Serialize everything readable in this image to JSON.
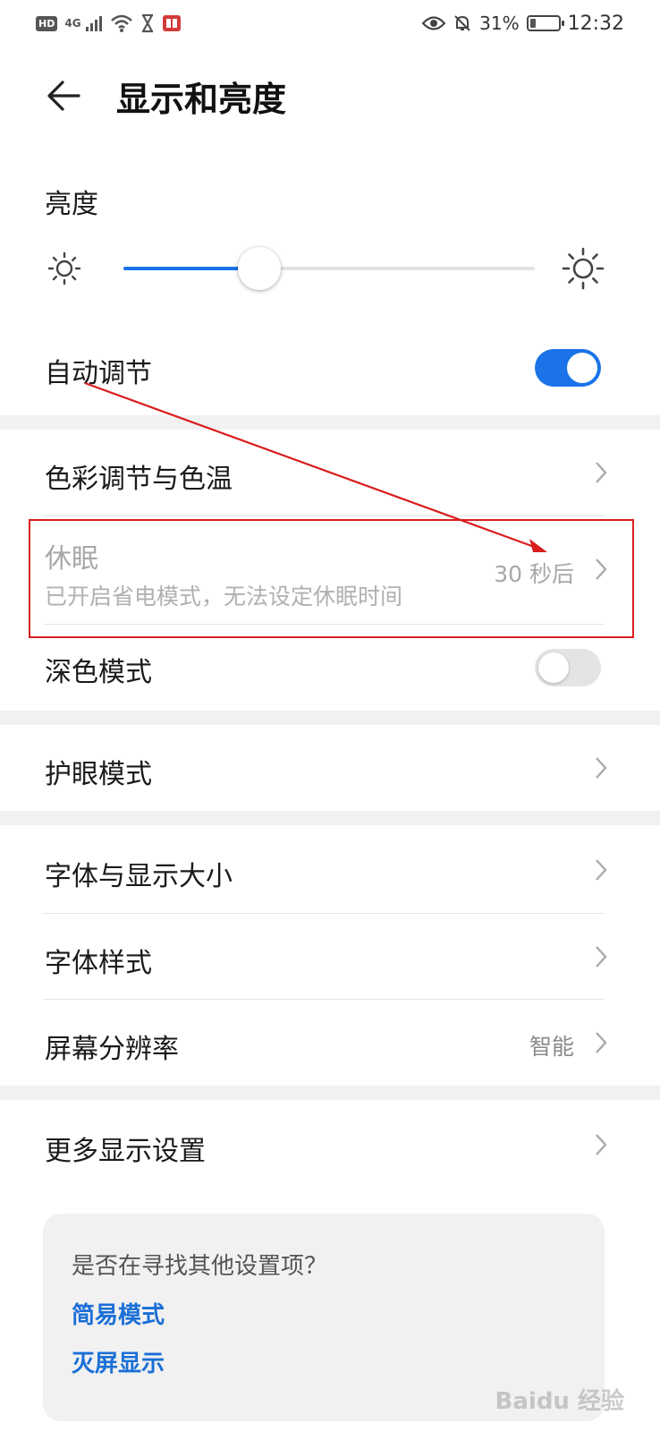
{
  "status_bar": {
    "hd": "HD",
    "network": "4G",
    "battery_percent": "31%",
    "battery_level": 0.31,
    "time": "12:32",
    "left_icons": [
      "hd-icon",
      "signal-icon",
      "wifi-icon",
      "hourglass-icon",
      "book-icon"
    ],
    "right_icons": [
      "eye-icon",
      "bell-off-icon",
      "battery-icon"
    ]
  },
  "header": {
    "title": "显示和亮度"
  },
  "brightness": {
    "label": "亮度",
    "level": 0.33,
    "accent": "#1a73e8"
  },
  "auto_adjust": {
    "label": "自动调节",
    "on": true
  },
  "color_temp": {
    "label": "色彩调节与色温"
  },
  "sleep": {
    "label": "休眠",
    "sub": "已开启省电模式，无法设定休眠时间",
    "value": "30 秒后",
    "disabled": true
  },
  "dark_mode": {
    "label": "深色模式",
    "on": false
  },
  "eye_comfort": {
    "label": "护眼模式"
  },
  "font_size": {
    "label": "字体与显示大小"
  },
  "font_style": {
    "label": "字体样式"
  },
  "resolution": {
    "label": "屏幕分辨率",
    "value": "智能"
  },
  "more_display": {
    "label": "更多显示设置"
  },
  "suggestions": {
    "question": "是否在寻找其他设置项？",
    "links": [
      "简易模式",
      "灭屏显示"
    ]
  },
  "annotation": {
    "color": "#d81e1e"
  },
  "watermark": "Baidu经验"
}
